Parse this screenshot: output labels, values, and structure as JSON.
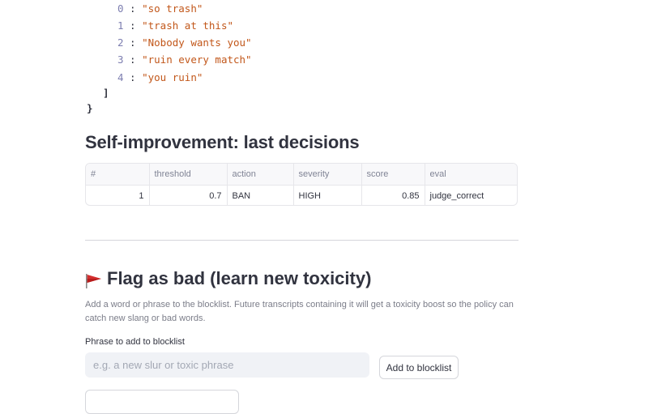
{
  "json_view": {
    "items": [
      {
        "index": "0",
        "value": "\"so trash\""
      },
      {
        "index": "1",
        "value": "\"trash at this\""
      },
      {
        "index": "2",
        "value": "\"Nobody wants you\""
      },
      {
        "index": "3",
        "value": "\"ruin every match\""
      },
      {
        "index": "4",
        "value": "\"you ruin\""
      }
    ],
    "close_bracket": "]",
    "close_brace": "}"
  },
  "decisions": {
    "title": "Self-improvement: last decisions",
    "columns": [
      "#",
      "threshold",
      "action",
      "severity",
      "score",
      "eval"
    ],
    "rows": [
      {
        "n": "1",
        "threshold": "0.7",
        "action": "BAN",
        "severity": "HIGH",
        "score": "0.85",
        "eval": "judge_correct"
      }
    ]
  },
  "flag": {
    "icon": "red-flag-icon",
    "title": "Flag as bad (learn new toxicity)",
    "description": "Add a word or phrase to the blocklist. Future transcripts containing it will get a toxicity boost so the policy can catch new slang or bad words.",
    "field_label": "Phrase to add to blocklist",
    "placeholder": "e.g. a new slur or toxic phrase",
    "button_label": "Add to blocklist"
  },
  "colors": {
    "string": "#c2571a",
    "index": "#7d7eb0",
    "flag": "#d32f2f"
  }
}
